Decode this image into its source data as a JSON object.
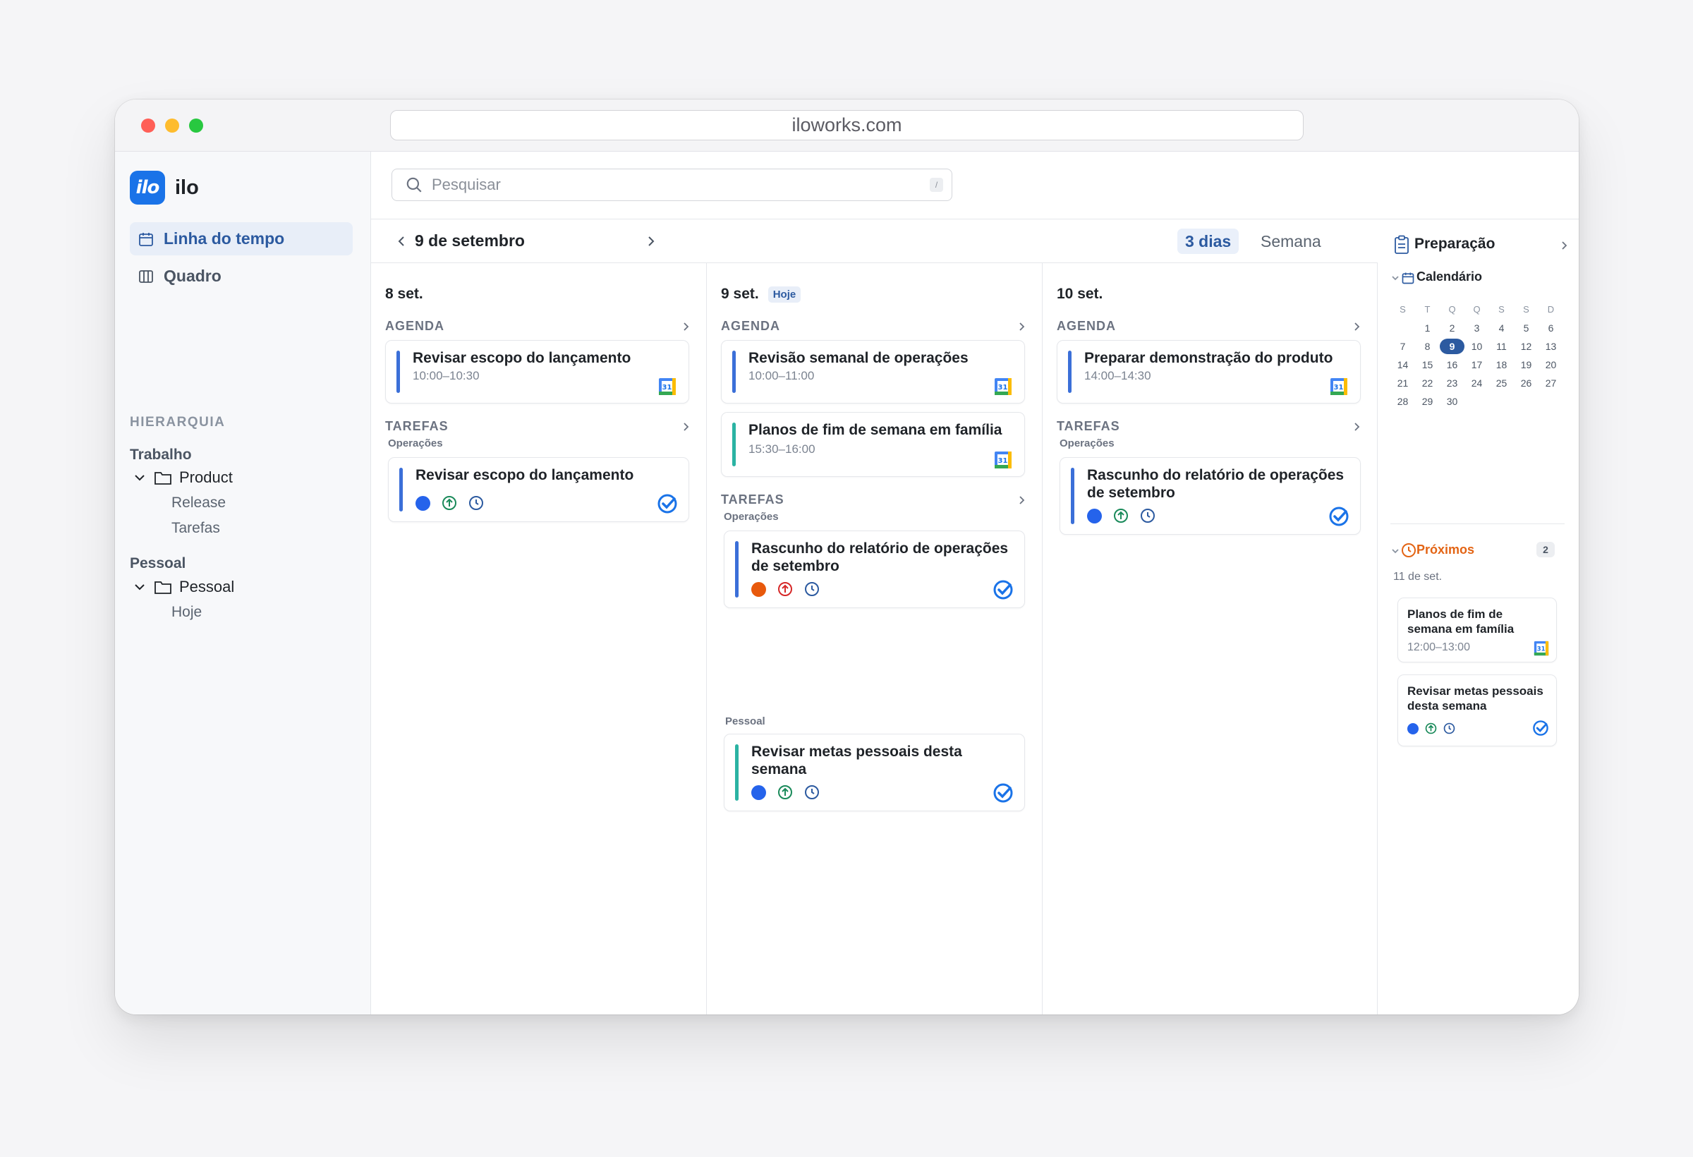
{
  "browser": {
    "url": "iloworks.com"
  },
  "sidebar": {
    "logo_text": "ilo",
    "brand": "ilo",
    "nav": [
      {
        "label": "Linha do tempo"
      },
      {
        "label": "Quadro"
      }
    ],
    "hierarchy_heading": "HIERARQUIA",
    "groups": [
      {
        "label": "Trabalho",
        "folder": "Product",
        "children": [
          "Release",
          "Tarefas"
        ]
      },
      {
        "label": "Pessoal",
        "folder": "Pessoal",
        "children": [
          "Hoje"
        ]
      }
    ]
  },
  "topbar": {
    "search_placeholder": "Pesquisar",
    "search_shortcut": "/"
  },
  "datebar": {
    "title": "9 de setembro",
    "views": [
      "3 dias",
      "Semana"
    ],
    "active_view": "3 dias"
  },
  "columns": [
    {
      "header": "8 set.",
      "agenda_label": "AGENDA",
      "tasks_label": "TAREFAS",
      "events": [
        {
          "title": "Revisar escopo do lançamento",
          "time": "10:00–10:30",
          "color": "#3b6fd8"
        }
      ],
      "task_groups": [
        {
          "label": "Operações",
          "tasks": [
            {
              "title": "Revisar escopo do lançamento",
              "priority_color": "#2563eb",
              "arrow_color": "#1a8a5a",
              "bar_color": "#3b6fd8"
            }
          ]
        }
      ]
    },
    {
      "header": "9 set.",
      "today_badge": "Hoje",
      "agenda_label": "AGENDA",
      "tasks_label": "TAREFAS",
      "events": [
        {
          "title": "Revisão semanal de operações",
          "time": "10:00–11:00",
          "color": "#3b6fd8"
        },
        {
          "title": "Planos de fim de semana em família",
          "time": "15:30–16:00",
          "color": "#2bb3a3"
        }
      ],
      "task_groups": [
        {
          "label": "Operações",
          "tasks": [
            {
              "title": "Rascunho do relatório de operações de setembro",
              "priority_color": "#e8590c",
              "arrow_color": "#d62828",
              "bar_color": "#3b6fd8"
            }
          ]
        },
        {
          "label": "Pessoal",
          "tasks": [
            {
              "title": "Revisar metas pessoais desta semana",
              "priority_color": "#2563eb",
              "arrow_color": "#1a8a5a",
              "bar_color": "#2bb3a3"
            }
          ]
        }
      ]
    },
    {
      "header": "10 set.",
      "agenda_label": "AGENDA",
      "tasks_label": "TAREFAS",
      "events": [
        {
          "title": "Preparar demonstração do produto",
          "time": "14:00–14:30",
          "color": "#3b6fd8"
        }
      ],
      "task_groups": [
        {
          "label": "Operações",
          "tasks": [
            {
              "title": "Rascunho do relatório de operações de setembro",
              "priority_color": "#2563eb",
              "arrow_color": "#1a8a5a",
              "bar_color": "#3b6fd8"
            }
          ]
        }
      ]
    }
  ],
  "right_panel": {
    "title": "Preparação",
    "calendar_label": "Calendário",
    "weekdays": [
      "S",
      "T",
      "Q",
      "Q",
      "S",
      "S",
      "D"
    ],
    "days": [
      "",
      "1",
      "2",
      "3",
      "4",
      "5",
      "6",
      "7",
      "8",
      "9",
      "10",
      "11",
      "12",
      "13",
      "14",
      "15",
      "16",
      "17",
      "18",
      "19",
      "20",
      "21",
      "22",
      "23",
      "24",
      "25",
      "26",
      "27",
      "28",
      "29",
      "30"
    ],
    "selected_day": "9",
    "upcoming_label": "Próximos",
    "upcoming_count": "2",
    "upcoming_date": "11 de set.",
    "upcoming": [
      {
        "title": "Planos de fim de semana em família",
        "time": "12:00–13:00",
        "type": "event"
      },
      {
        "title": "Revisar metas pessoais desta semana",
        "type": "task"
      }
    ]
  },
  "colors": {
    "accent": "#2c5aa0",
    "upcoming": "#e36414",
    "check": "#1a73e8"
  }
}
